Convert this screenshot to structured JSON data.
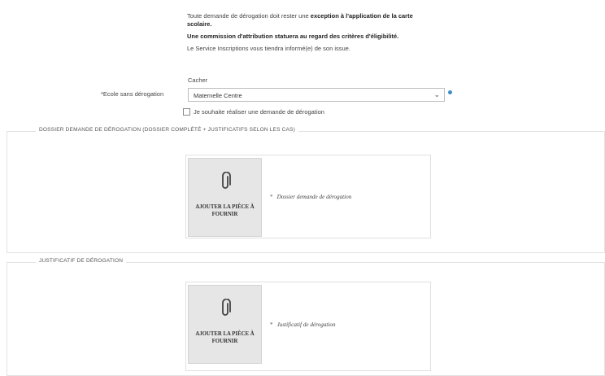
{
  "info": {
    "line1_pre": "Toute demande de dérogation doit rester une ",
    "line1_bold": "exception à l'application de la carte",
    "line1_bold_cont": "scolaire.",
    "line2": "Une commission d'attribution statuera au regard des critères d'éligibilité.",
    "line3": "Le Service Inscriptions vous tiendra informé(e) de son issue."
  },
  "form": {
    "hide_link": "Cacher",
    "school_label": "*Ecole sans dérogation",
    "school_value": "Maternelle Centre",
    "derogation_checkbox_label": "Je souhaite réaliser une demande de dérogation",
    "derogation_checked": false,
    "info_dot_color": "#3b8fc8"
  },
  "sections": [
    {
      "legend": "DOSSIER DEMANDE DE DÉROGATION (DOSSIER COMPLÉTÉ + JUSTIFICATIFS SELON LES CAS)",
      "upload_label": "AJOUTER LA PIÈCE À FOURNIR",
      "required_mark": "*",
      "document_label": "Dossier demande de dérogation"
    },
    {
      "legend": "JUSTIFICATIF DE DÉROGATION",
      "upload_label": "AJOUTER LA PIÈCE À FOURNIR",
      "required_mark": "*",
      "document_label": "Justificatif de dérogation"
    }
  ]
}
